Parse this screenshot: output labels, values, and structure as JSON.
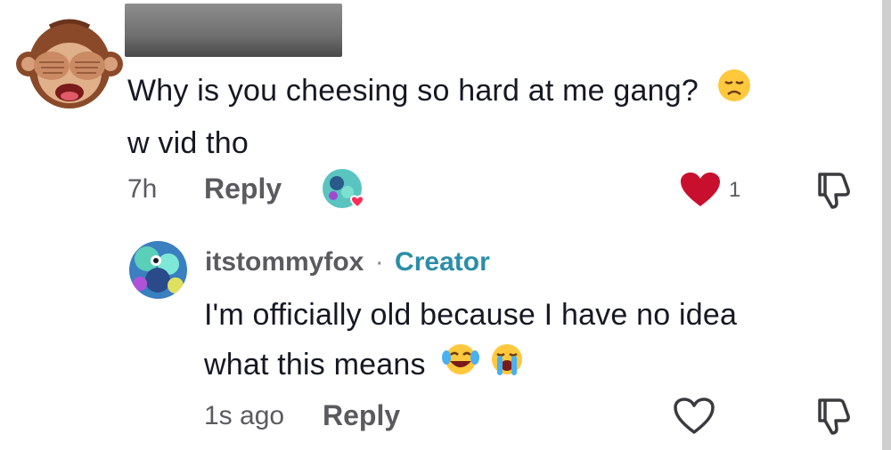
{
  "comment": {
    "avatar_icon": "see-no-evil-monkey-icon",
    "text_line1": "Why is you cheesing so hard at me gang?",
    "text_line2": "w vid tho",
    "text_emoji": "disappointed-face-emoji",
    "time": "7h",
    "reply_label": "Reply",
    "creator_liked_icon": "creator-liked-avatar-icon",
    "like_count": "1",
    "liked": true,
    "dislike_icon": "thumbs-down-icon"
  },
  "reply": {
    "author": "itstommyfox",
    "separator": "·",
    "badge": "Creator",
    "text_line1": "I'm officially old because I have no idea",
    "text_line2": "what this means",
    "emojis": [
      "face-with-tears-of-joy-emoji",
      "loudly-crying-face-emoji"
    ],
    "time": "1s ago",
    "reply_label": "Reply",
    "liked": false,
    "dislike_icon": "thumbs-down-icon"
  },
  "colors": {
    "like_red": "#c8102e",
    "creator_blue": "#2b8ea8",
    "meta_gray": "#5a5a5f",
    "text_dark": "#161823"
  }
}
